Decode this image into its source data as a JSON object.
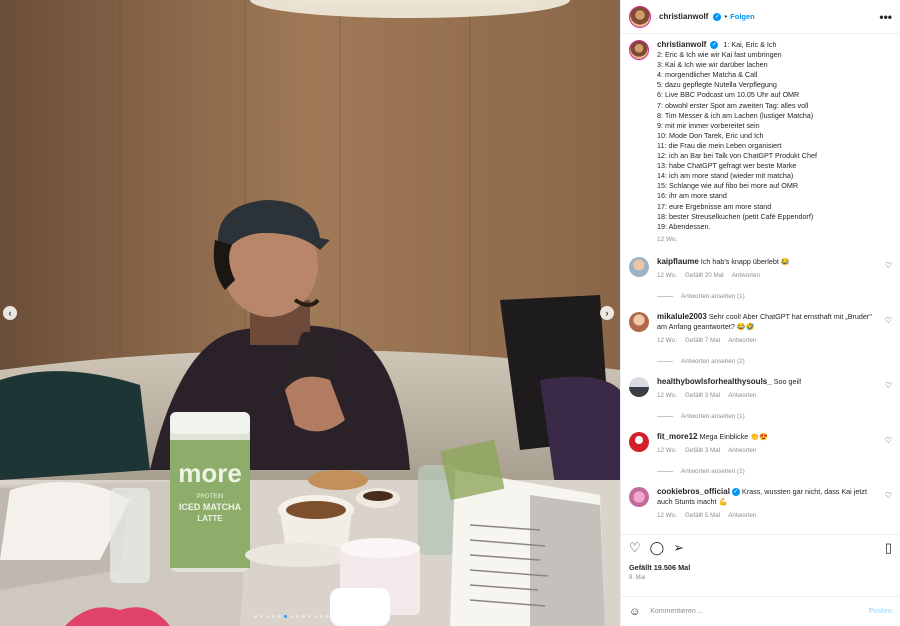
{
  "header": {
    "username": "christianwolf",
    "separator": "•",
    "follow_label": "Folgen",
    "more_label": "•••"
  },
  "caption": {
    "username": "christianwolf",
    "lines": [
      "1: Kai, Eric & Ich",
      "2: Eric & Ich wie wir Kai fast umbringen",
      "3: Kai & Ich wie wir darüber lachen",
      "4: morgendlicher Matcha & Call",
      "5: dazu gepflegte Nutella Verpflegung",
      "6: Live BBC Podcast um 10.05 Uhr auf OMR",
      "7: obwohl erster Spot am zweiten Tag: alles voll",
      "8: Tim Messer & ich am Lachen (lustiger Matcha)",
      "9: mit mir immer vorbereitet sein",
      "10: Mode Don Tarek, Eric und Ich",
      "11: die Frau die mein Leben organisiert",
      "12: ich an Bar bei Talk von ChatGPT Produkt Chef",
      "13: habe ChatGPT gefragt wer beste Marke",
      "14: ich am more stand (wieder mit matcha)",
      "15: Schlange wie auf fibo bei more auf OMR",
      "16: ihr am more stand",
      "17: eure Ergebnisse am more stand",
      "18: bester Streuselkuchen (petit Café Eppendorf)",
      "19: Abendessen."
    ],
    "age": "12 Wo."
  },
  "comments": [
    {
      "username": "kaipflaume",
      "verified": false,
      "text": "Ich hab's knapp überlebt 😂",
      "age": "12 Wo.",
      "likes": "Gefällt 20 Mal",
      "reply": "Antworten",
      "view_replies": "Antworten ansehen (1)",
      "avatar_class": "av-kai"
    },
    {
      "username": "mikalule2003",
      "verified": false,
      "text": "Sehr cool! Aber ChatGPT hat ernsthaft mit „Bruder\" am Anfang geantwortet? 😂🤣",
      "age": "12 Wo.",
      "likes": "Gefällt 7 Mal",
      "reply": "Antworten",
      "view_replies": "Antworten ansehen (2)",
      "avatar_class": "av-mika"
    },
    {
      "username": "healthybowlsforhealthysouls_",
      "verified": false,
      "text": "Soo geil!",
      "age": "12 Wo.",
      "likes": "Gefällt 3 Mal",
      "reply": "Antworten",
      "view_replies": "Antworten ansehen (1)",
      "avatar_class": "av-healthy"
    },
    {
      "username": "fit_more12",
      "verified": false,
      "text": "Mega Einblicke 👏😍",
      "age": "12 Wo.",
      "likes": "Gefällt 3 Mal",
      "reply": "Antworten",
      "view_replies": "Antworten ansehen (1)",
      "avatar_class": "av-fit"
    },
    {
      "username": "cookiebros_official",
      "verified": true,
      "text": "Krass, wussten gar nicht, dass Kai jetzt auch Stunts macht 💪",
      "age": "12 Wo.",
      "likes": "Gefällt 5 Mal",
      "reply": "Antworten",
      "view_replies": "",
      "avatar_class": "av-cookie"
    }
  ],
  "actions": {
    "like_icon": "heart-outline-icon",
    "comment_icon": "comment-icon",
    "share_icon": "send-icon",
    "save_icon": "bookmark-icon",
    "likes": "Gefällt 19.506 Mal",
    "date": "8. Mai"
  },
  "composer": {
    "placeholder": "Kommentieren ...",
    "post_label": "Posten"
  },
  "photo": {
    "tub_brand": "more",
    "tub_line1": "PROTEIN",
    "tub_line2": "ICED MATCHA",
    "tub_line3": "LATTE"
  },
  "colors": {
    "accent": "#0095f6",
    "muted": "#8e8e8e",
    "post_disabled": "#b2dffc"
  }
}
